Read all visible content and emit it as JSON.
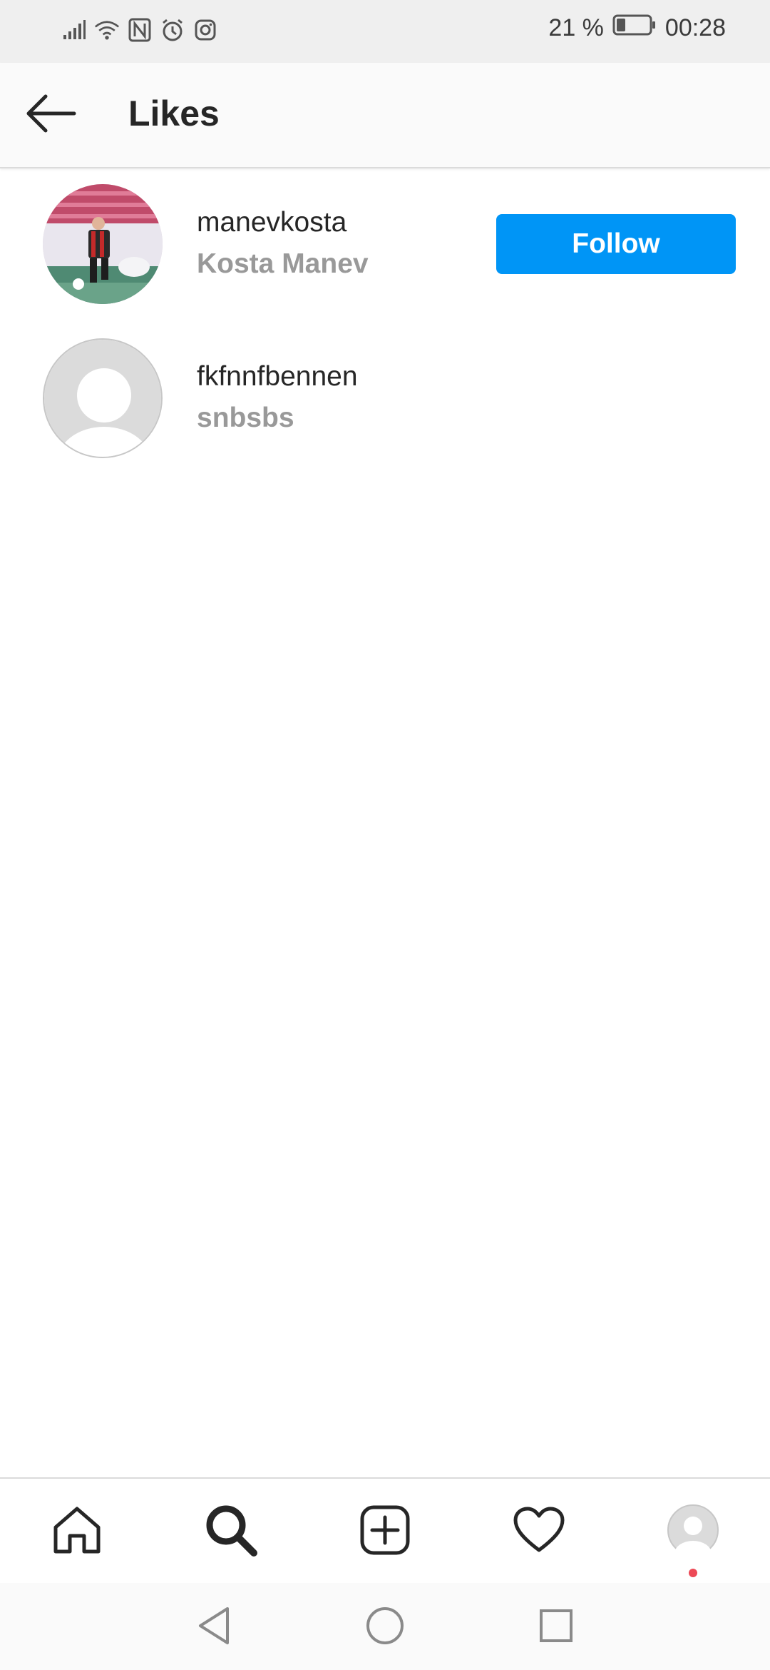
{
  "status_bar": {
    "battery": "21 %",
    "time": "00:28",
    "icons": [
      "signal-icon",
      "wifi-icon",
      "nfc-icon",
      "alarm-icon",
      "instagram-icon"
    ]
  },
  "header": {
    "title": "Likes",
    "back_icon": "back-arrow-icon"
  },
  "likes": [
    {
      "username": "manevkosta",
      "full_name": "Kosta Manev",
      "action": "Follow",
      "avatar": "photo"
    },
    {
      "username": "fkfnnfbennen",
      "full_name": "snbsbs",
      "avatar": "default-silhouette"
    }
  ],
  "bottom_nav": {
    "items": [
      "home-icon",
      "search-icon",
      "new-post-icon",
      "activity-heart-icon",
      "profile-avatar-icon"
    ]
  },
  "system_nav": {
    "items": [
      "back-triangle-icon",
      "home-circle-icon",
      "recents-square-icon"
    ]
  },
  "colors": {
    "follow_button": "#0095f6",
    "notification_dot": "#ed4956",
    "secondary_text": "#999999"
  }
}
